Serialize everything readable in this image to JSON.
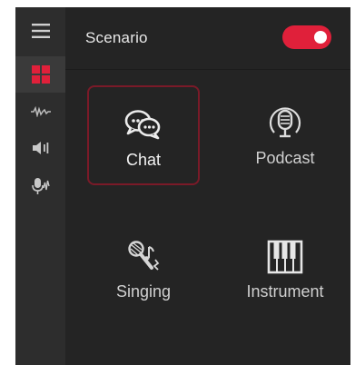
{
  "header": {
    "title": "Scenario",
    "toggle_on": true
  },
  "sidebar": {
    "items": [
      {
        "icon": "menu-icon",
        "active": false
      },
      {
        "icon": "grid-icon",
        "active": true
      },
      {
        "icon": "waveform-icon",
        "active": false
      },
      {
        "icon": "speaker-icon",
        "active": false
      },
      {
        "icon": "voice-mic-icon",
        "active": false
      }
    ]
  },
  "scenarios": [
    {
      "label": "Chat",
      "icon": "chat-bubbles-icon",
      "selected": true
    },
    {
      "label": "Podcast",
      "icon": "podcast-mic-icon",
      "selected": false
    },
    {
      "label": "Singing",
      "icon": "singing-mic-icon",
      "selected": false
    },
    {
      "label": "Instrument",
      "icon": "piano-keys-icon",
      "selected": false
    }
  ],
  "colors": {
    "accent": "#e0203a",
    "selected_border": "#7a1a28",
    "panel_bg": "#242424",
    "rail_bg": "#2d2d2d"
  }
}
